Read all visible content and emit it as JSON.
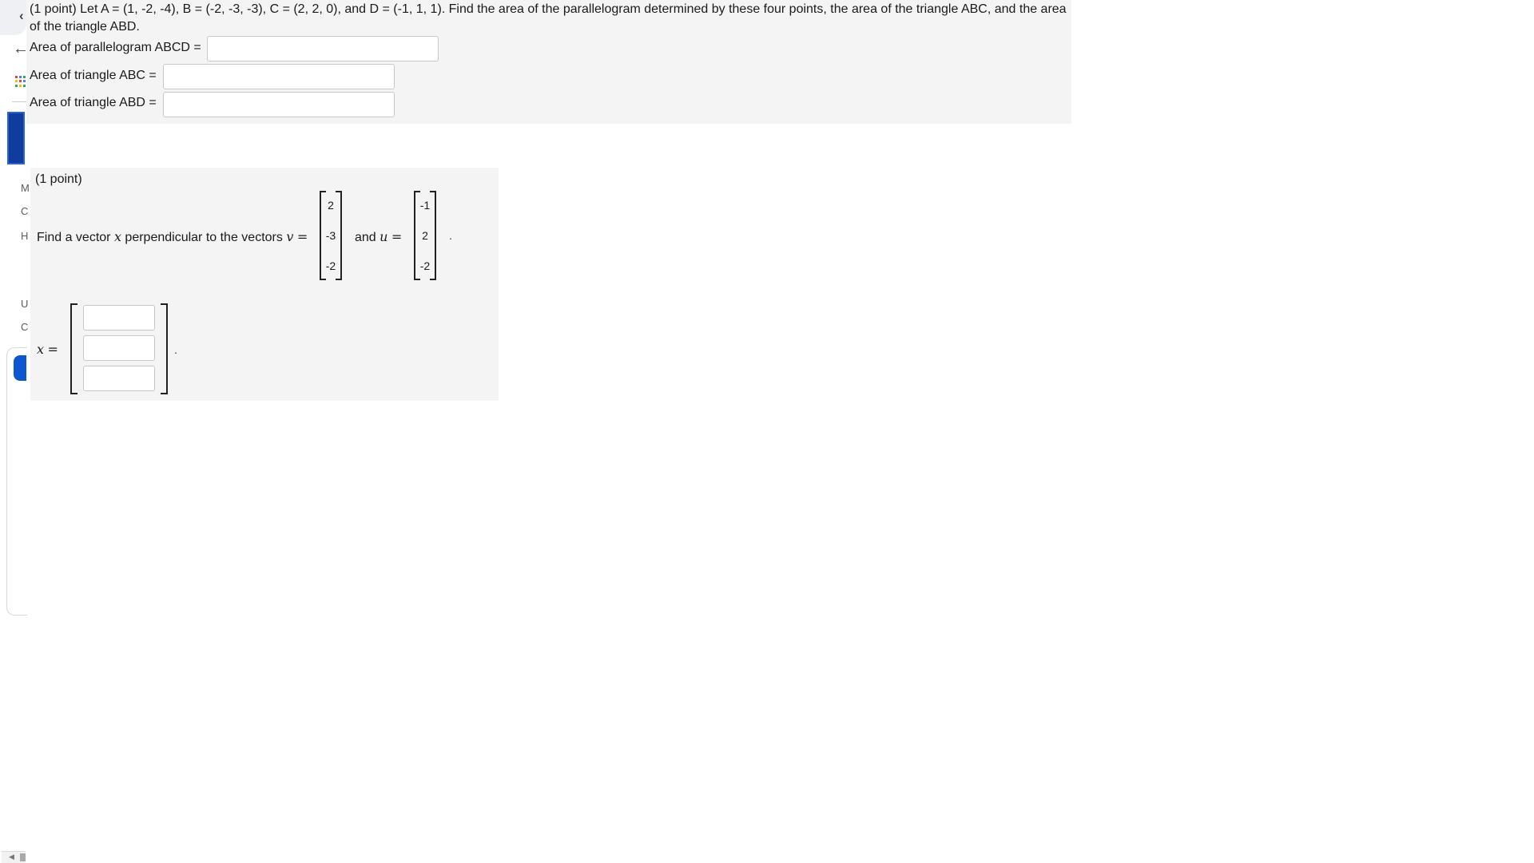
{
  "problem1": {
    "text": "(1 point) Let A = (1, -2, -4), B = (-2, -3, -3), C = (2, 2, 0), and D = (-1, 1, 1). Find the area of the parallelogram determined by these four points, the area of the triangle ABC, and the area of the triangle ABD.",
    "fields": [
      {
        "label": "Area of parallelogram ABCD =",
        "value": ""
      },
      {
        "label": "Area of triangle ABC =",
        "value": ""
      },
      {
        "label": "Area of triangle ABD =",
        "value": ""
      }
    ]
  },
  "problem2": {
    "points": "(1 point)",
    "statement_prefix": "Find a vector",
    "var_x": "x",
    "statement_mid": "perpendicular to the vectors",
    "var_v": "v",
    "equals": "=",
    "and_text": "and",
    "var_u": "u",
    "v": [
      "2",
      "-3",
      "-2"
    ],
    "u": [
      "-1",
      "2",
      "-2"
    ],
    "period": ".",
    "answer_label_var": "x",
    "answer_values": [
      "",
      "",
      ""
    ]
  },
  "sidebar": {
    "back_icon": "arrow-left-icon",
    "apps_icon": "apps-grid-icon",
    "letters": [
      "M",
      "C",
      "H",
      "U",
      "C"
    ],
    "grid_colors": [
      "#ea4335",
      "#4285f4",
      "#34a853",
      "#fbbc04",
      "#ea4335",
      "#4285f4",
      "#34a853",
      "#fbbc04",
      "#34a853"
    ]
  }
}
